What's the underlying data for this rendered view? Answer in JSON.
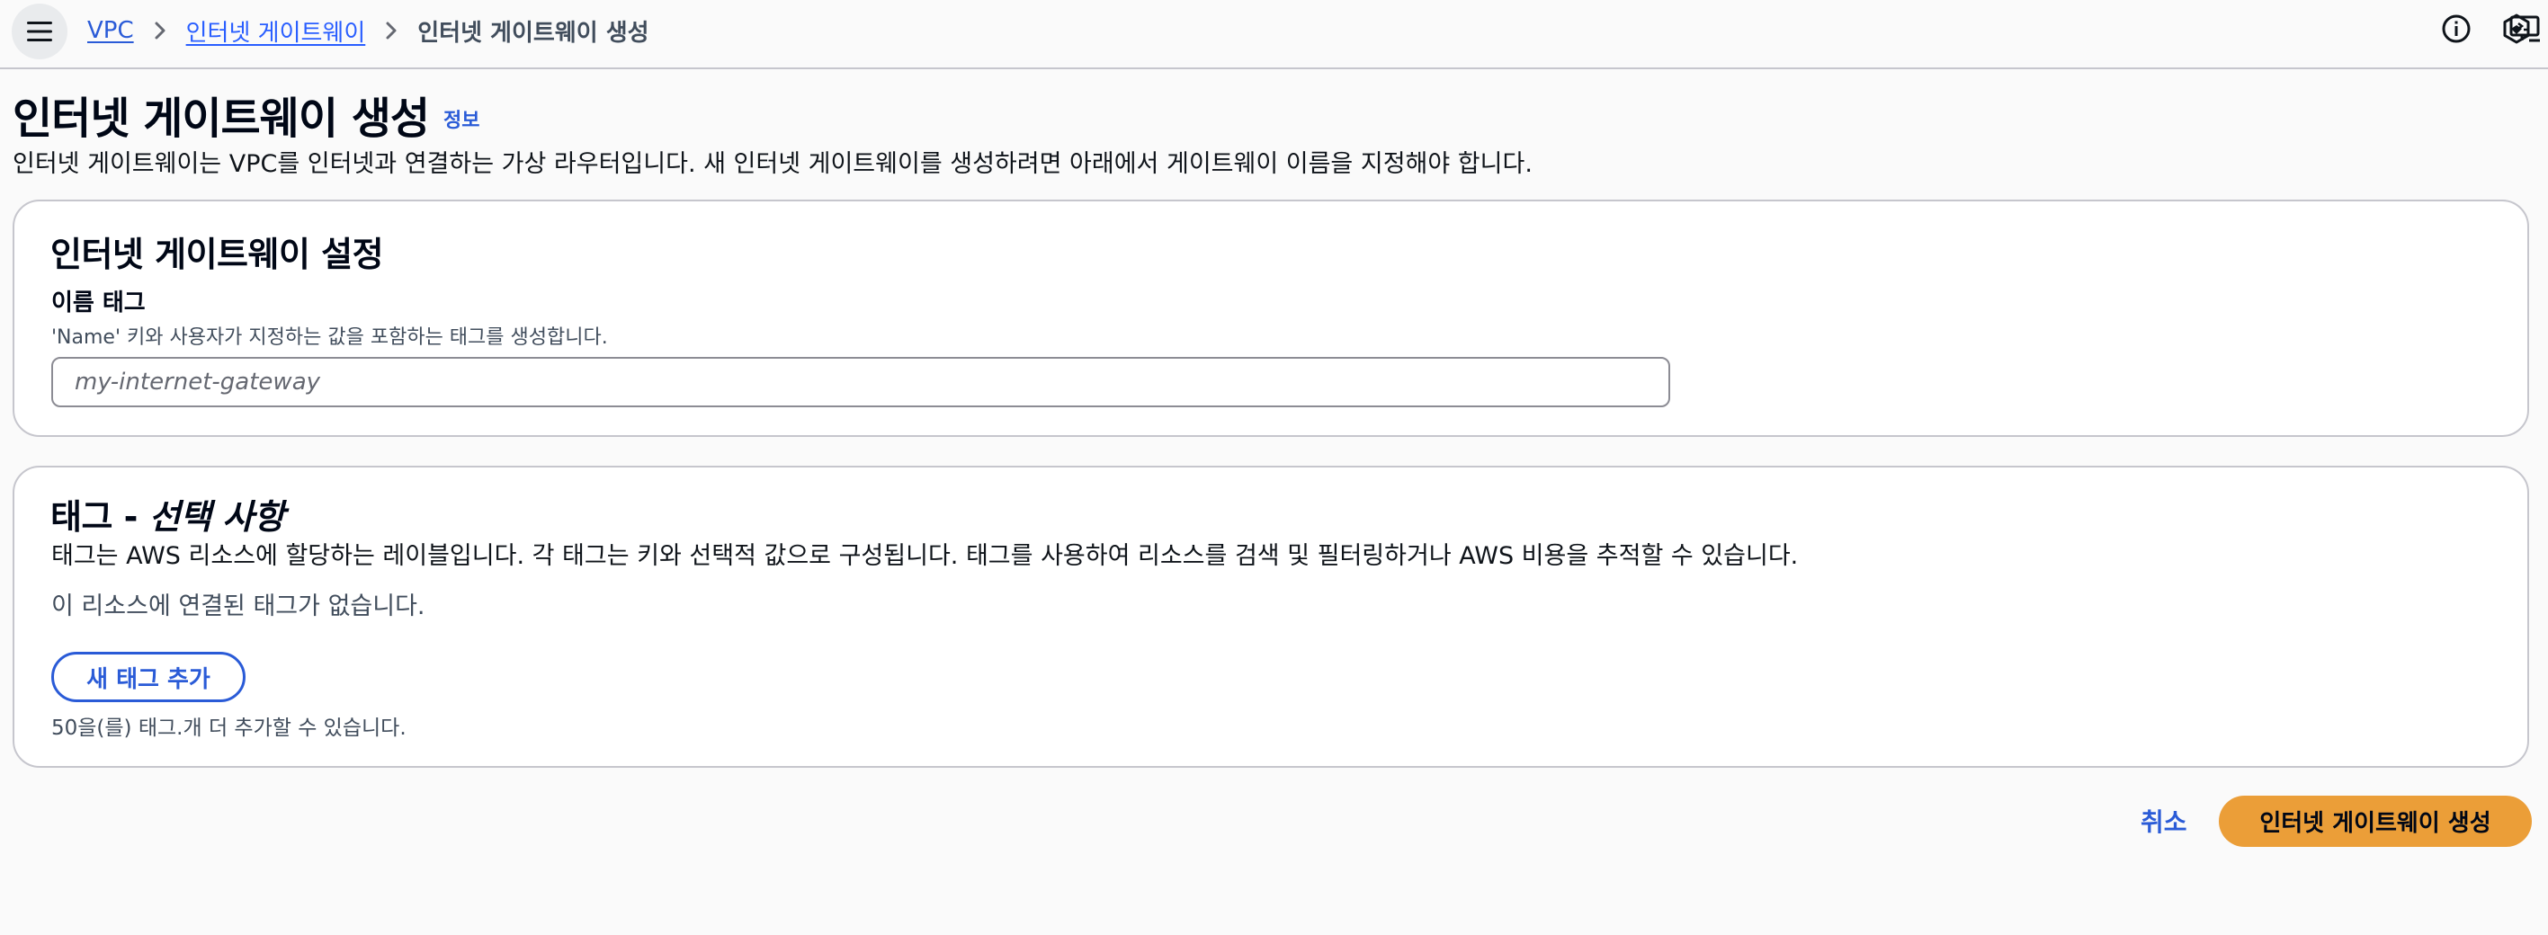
{
  "breadcrumb": {
    "items": [
      "VPC",
      "인터넷 게이트웨이"
    ],
    "current": "인터넷 게이트웨이 생성"
  },
  "icons": {
    "menu": "menu-icon",
    "separator": "chevron-right-icon",
    "info": "info-icon",
    "feedback": "feedback-screen-icon",
    "settings": "hexagon-settings-icon"
  },
  "header": {
    "title": "인터넷 게이트웨이 생성",
    "info_link": "정보",
    "description": "인터넷 게이트웨이는 VPC를 인터넷과 연결하는 가상 라우터입니다. 새 인터넷 게이트웨이를 생성하려면 아래에서 게이트웨이 이름을 지정해야 합니다."
  },
  "settings_card": {
    "title": "인터넷 게이트웨이 설정",
    "name_tag_label": "이름 태그",
    "name_tag_description": "'Name' 키와 사용자가 지정하는 값을 포함하는 태그를 생성합니다.",
    "name_tag_value": "",
    "name_tag_placeholder": "my-internet-gateway"
  },
  "tags_card": {
    "title_main": "태그 - ",
    "title_optional": "선택 사항",
    "description": "태그는 AWS 리소스에 할당하는 레이블입니다. 각 태그는 키와 선택적 값으로 구성됩니다. 태그를 사용하여 리소스를 검색 및 필터링하거나 AWS 비용을 추적할 수 있습니다.",
    "empty_message": "이 리소스에 연결된 태그가 없습니다.",
    "add_button": "새 태그 추가",
    "limit_text": "50을(를) 태그.개 더 추가할 수 있습니다."
  },
  "footer": {
    "cancel_label": "취소",
    "submit_label": "인터넷 게이트웨이 생성"
  },
  "colors": {
    "link": "#2a5bd7",
    "primary_button": "#eb9e38",
    "border": "#c6c6cd",
    "background": "#fafafa"
  }
}
